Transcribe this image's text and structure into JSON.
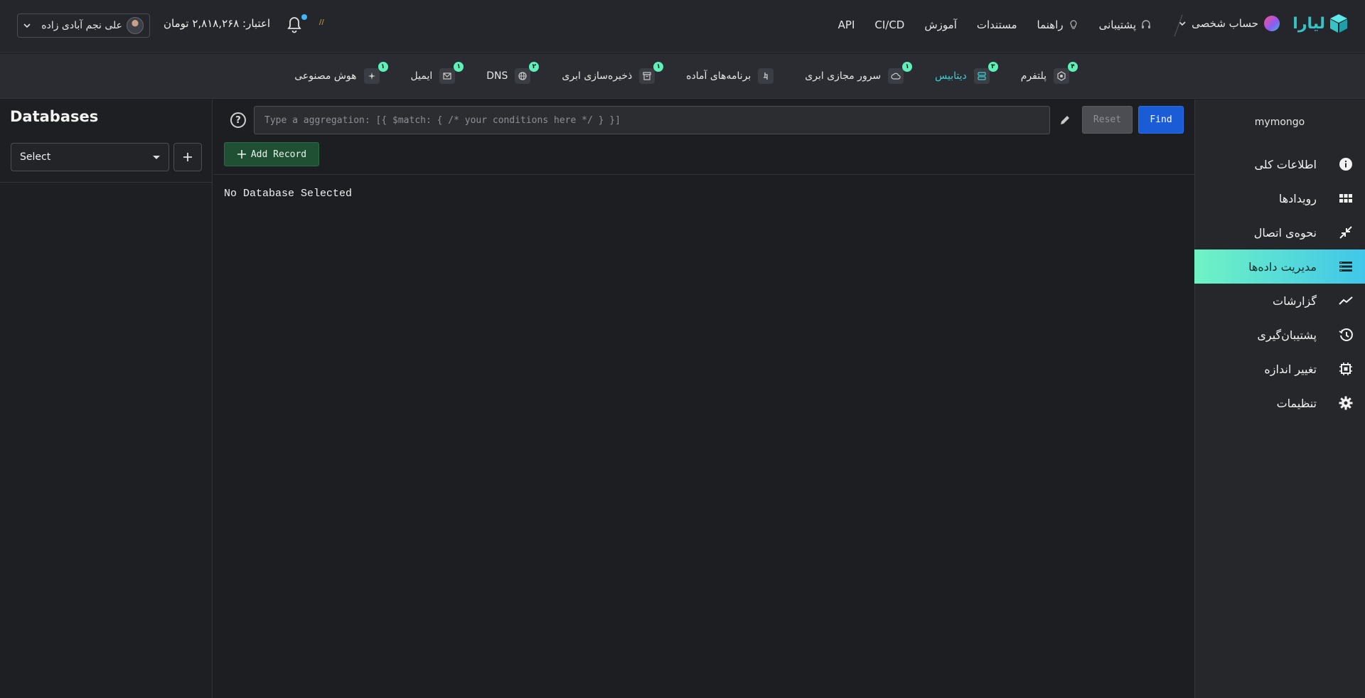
{
  "brand": {
    "name": "لیارا",
    "color": "#35c4c6"
  },
  "account": {
    "label": "حساب شخصی"
  },
  "topnav": [
    {
      "label": "پشتیبانی",
      "icon": "headset-icon"
    },
    {
      "label": "راهنما",
      "icon": "lightbulb-icon"
    },
    {
      "label": "مستندات"
    },
    {
      "label": "آموزش"
    },
    {
      "label": "CI/CD"
    },
    {
      "label": "API"
    }
  ],
  "credit": {
    "text": "اعتبار: ۲,۸۱۸,۲۶۸ تومان"
  },
  "mini_badge": "//",
  "user": {
    "name": "علی نجم آبادی زاده"
  },
  "services": [
    {
      "label": "پلتفرم",
      "badge": "۴",
      "icon": "platform-icon"
    },
    {
      "label": "دیتابیس",
      "badge": "۳",
      "icon": "database-icon",
      "active": true
    },
    {
      "label": "سرور مجازی ابری",
      "badge": "۱",
      "icon": "cloud-icon"
    },
    {
      "label": "برنامه‌های آماده",
      "badge": "",
      "icon": "app-icon"
    },
    {
      "label": "ذخیره‌سازی ابری",
      "badge": "۱",
      "icon": "archive-icon"
    },
    {
      "label": "DNS",
      "badge": "۲",
      "icon": "globe-icon"
    },
    {
      "label": "ایمیل",
      "badge": "۱",
      "icon": "mail-icon"
    },
    {
      "label": "هوش مصنوعی",
      "badge": "۱",
      "icon": "sparkle-icon"
    }
  ],
  "sidebar": {
    "service_name": "mymongo",
    "items": [
      {
        "label": "اطلاعات کلی",
        "icon": "info-icon"
      },
      {
        "label": "رویدادها",
        "icon": "grid-icon"
      },
      {
        "label": "نحوه‌ی اتصال",
        "icon": "collapse-arrows-icon"
      },
      {
        "label": "مدیریت داده‌ها",
        "icon": "storage-list-icon",
        "active": true
      },
      {
        "label": "گزارشات",
        "icon": "trend-icon"
      },
      {
        "label": "پشتیبان‌گیری",
        "icon": "history-icon"
      },
      {
        "label": "تغییر اندازه",
        "icon": "chip-icon"
      },
      {
        "label": "تنظیمات",
        "icon": "gear-icon"
      }
    ]
  },
  "db_panel": {
    "title": "Databases",
    "select_value": "Select"
  },
  "main": {
    "help_icon": "?",
    "aggregation_placeholder": "Type a aggregation: [{ $match: { /* your conditions here */ } }]",
    "reset_label": "Reset",
    "find_label": "Find",
    "add_record_label": "Add Record",
    "empty_message": "No Database Selected"
  }
}
